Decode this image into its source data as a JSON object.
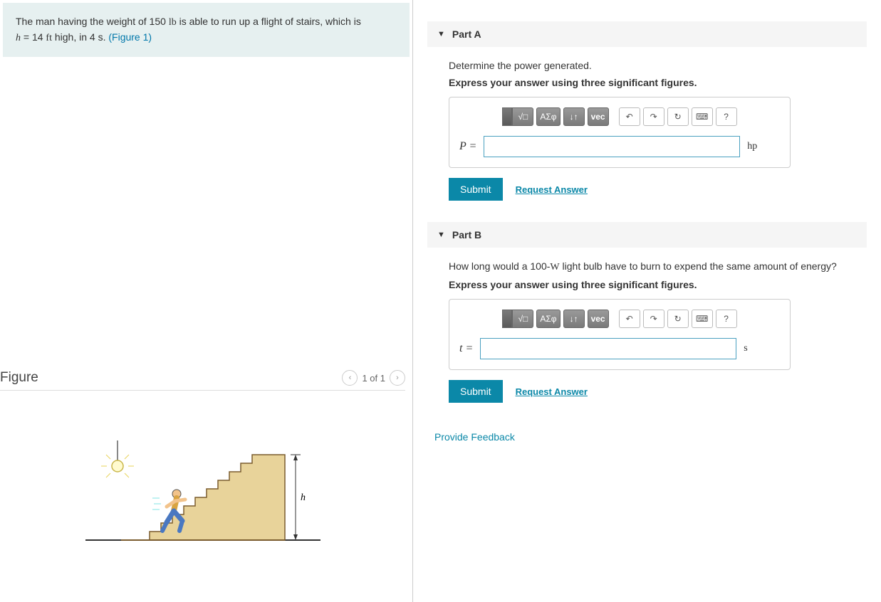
{
  "problem": {
    "text_before": "The man having the weight of 150 ",
    "unit_lb": "lb",
    "text_mid": " is able to run up a flight of stairs, which is ",
    "h_var": "h",
    "h_eq": " = 14  ",
    "unit_ft": "ft",
    "text_after": " high, in 4 s. ",
    "figure_ref": "(Figure 1)"
  },
  "figure": {
    "title": "Figure",
    "counter": "1 of 1",
    "dim_label": "h"
  },
  "partA": {
    "header": "Part A",
    "prompt": "Determine the power generated.",
    "instruction": "Express your answer using three significant figures.",
    "variable": "P =",
    "unit": "hp",
    "submit": "Submit",
    "request": "Request Answer"
  },
  "partB": {
    "header": "Part B",
    "prompt_before": "How long would a 100-",
    "prompt_unit": "W",
    "prompt_after": " light bulb have to burn to expend the same amount of energy?",
    "instruction": "Express your answer using three significant figures.",
    "variable": "t =",
    "unit": "s",
    "submit": "Submit",
    "request": "Request Answer"
  },
  "toolbar": {
    "templates_icon": "▭",
    "sqrt_icon": "√□",
    "greek": "ΑΣφ",
    "arrows": "↓↑",
    "vec": "vec",
    "undo": "↶",
    "redo": "↷",
    "reset": "↻",
    "keyboard": "⌨",
    "help": "?"
  },
  "feedback": "Provide Feedback"
}
